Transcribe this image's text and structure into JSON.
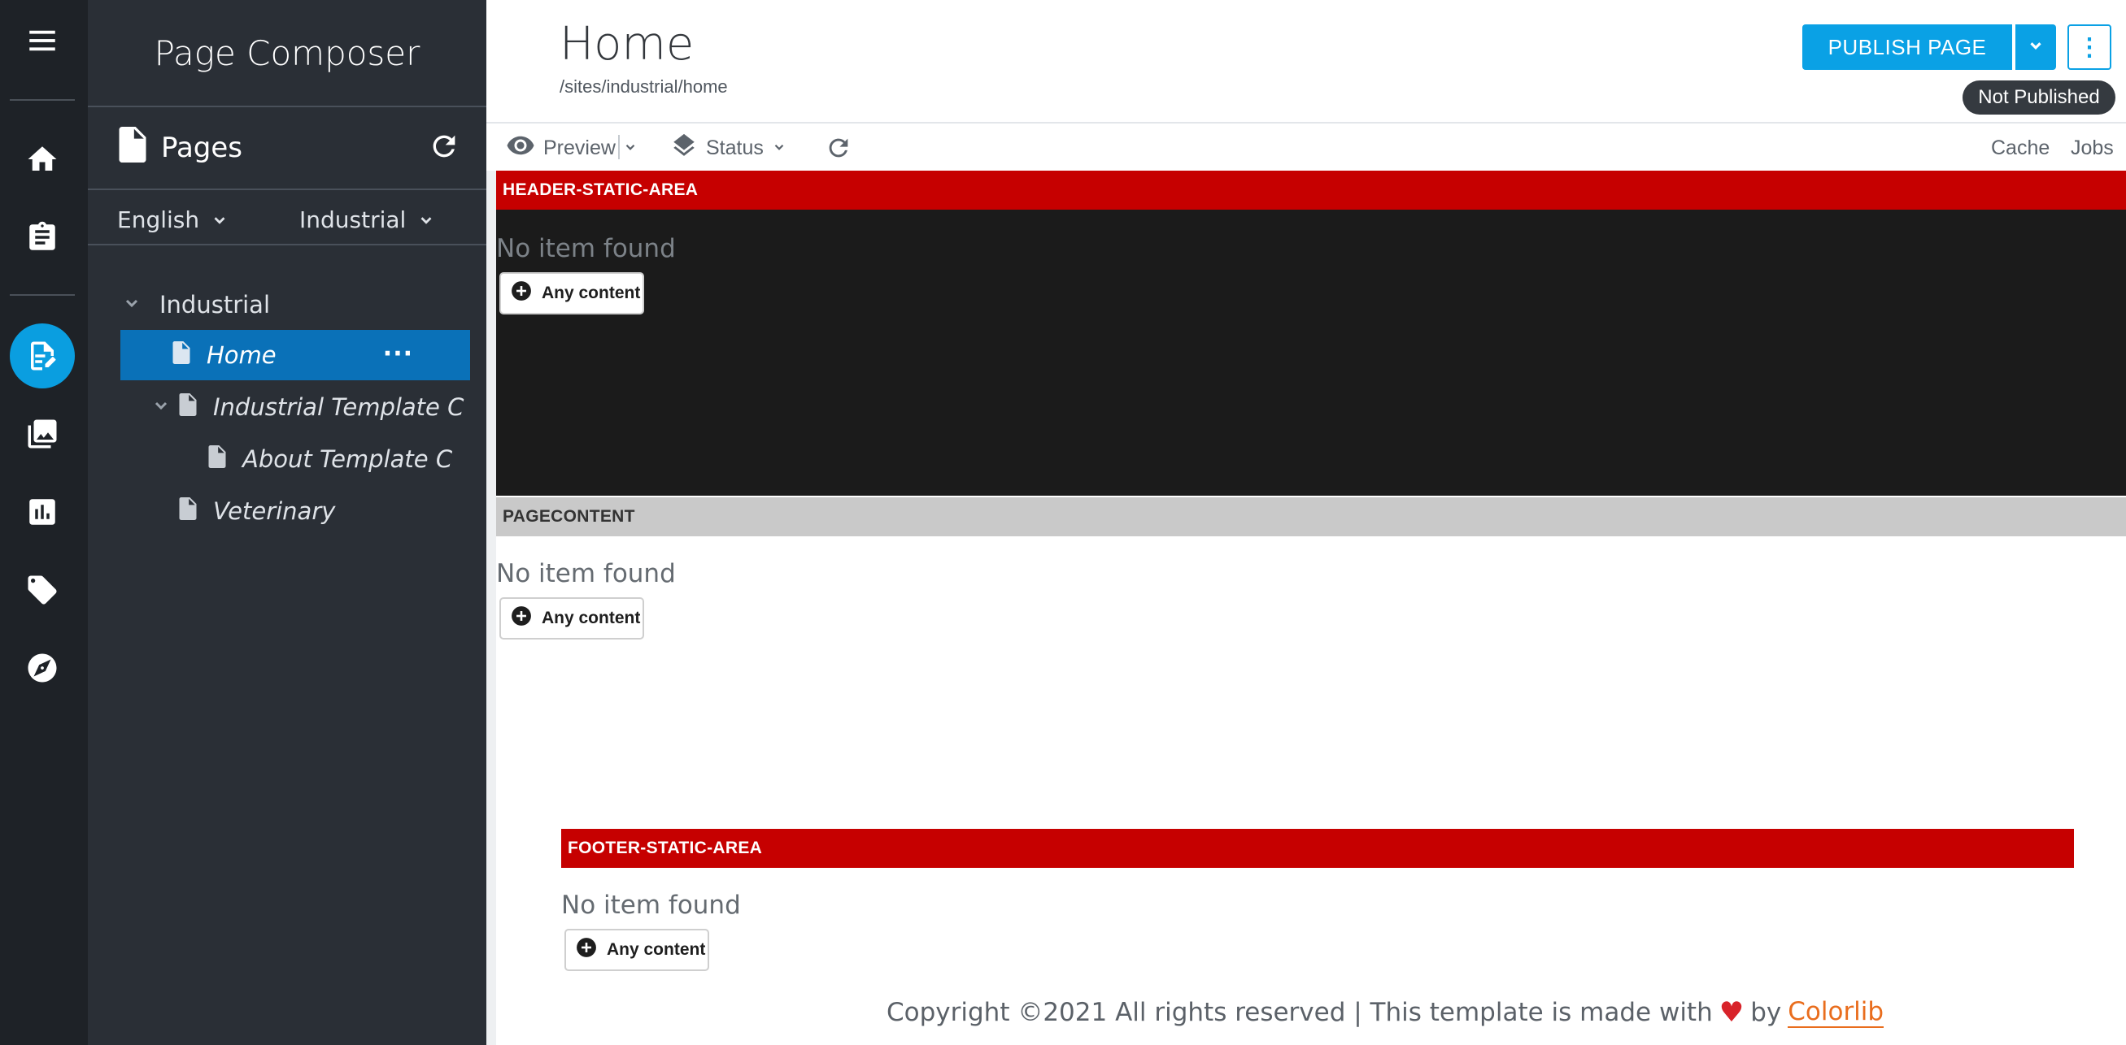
{
  "rail": {
    "items": [
      {
        "icon": "menu-icon"
      },
      {
        "icon": "home-icon"
      },
      {
        "icon": "clipboard-icon"
      },
      {
        "icon": "page-composer-icon",
        "active": true
      },
      {
        "icon": "image-icon"
      },
      {
        "icon": "bar-chart-icon"
      },
      {
        "icon": "tag-icon"
      },
      {
        "icon": "compass-icon"
      }
    ],
    "active_color": "#0a9ee0"
  },
  "sidebar": {
    "title": "Page Composer",
    "pages_label": "Pages",
    "language": "English",
    "site": "Industrial",
    "tree": [
      {
        "label": "Industrial",
        "level": 0,
        "expanded": true,
        "italic": false
      },
      {
        "label": "Home",
        "level": 1,
        "selected": true,
        "italic": true
      },
      {
        "label": "Industrial Template C",
        "level": 1,
        "expanded": true,
        "italic": true
      },
      {
        "label": "About Template C",
        "level": 2,
        "italic": true
      },
      {
        "label": "Veterinary",
        "level": 1,
        "italic": true
      }
    ],
    "more_label": "···"
  },
  "header": {
    "title": "Home",
    "path": "/sites/industrial/home",
    "publish_label": "PUBLISH PAGE",
    "status_badge": "Not Published",
    "kebab_label": "⋮",
    "accent_color": "#0aa1e5"
  },
  "toolbar": {
    "preview_label": "Preview",
    "status_label": "Status",
    "cache_label": "Cache",
    "jobs_label": "Jobs"
  },
  "zones": {
    "header_static": {
      "label": "HEADER-STATIC-AREA",
      "empty_text": "No item found",
      "button_label": "Any content"
    },
    "pagecontent": {
      "label": "PAGECONTENT",
      "empty_text": "No item found",
      "button_label": "Any content"
    },
    "footer_static": {
      "label": "FOOTER-STATIC-AREA",
      "empty_text": "No item found",
      "button_label": "Any content"
    },
    "zone_color": "#c60000"
  },
  "footer": {
    "copyright": "Copyright ©2021 All rights reserved | This template is made with",
    "heart": "♥",
    "by": "by",
    "brand": "Colorlib"
  }
}
